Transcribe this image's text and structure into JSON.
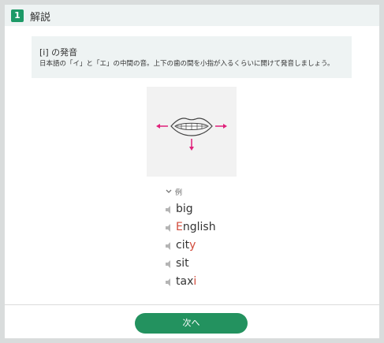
{
  "header": {
    "number": "1",
    "title": "解説"
  },
  "explanation": {
    "title": "[i] の発音",
    "body": "日本語の「イ」と「エ」の中間の音。上下の歯の間を小指が入るくらいに開けて発音しましょう。"
  },
  "examples": {
    "toggle_label": "例",
    "words": [
      {
        "parts": [
          {
            "t": "big",
            "h": false
          }
        ]
      },
      {
        "parts": [
          {
            "t": "E",
            "h": true
          },
          {
            "t": "nglish",
            "h": false
          }
        ]
      },
      {
        "parts": [
          {
            "t": "cit",
            "h": false
          },
          {
            "t": "y",
            "h": true
          }
        ]
      },
      {
        "parts": [
          {
            "t": "sit",
            "h": false
          }
        ]
      },
      {
        "parts": [
          {
            "t": "tax",
            "h": false
          },
          {
            "t": "i",
            "h": true
          }
        ]
      }
    ]
  },
  "footer": {
    "next_label": "次へ"
  },
  "colors": {
    "accent": "#23925f",
    "highlight": "#d14a3a",
    "arrow": "#e0207a"
  },
  "icons": [
    "mouth-diagram-icon",
    "chevron-down-icon",
    "speaker-icon"
  ]
}
